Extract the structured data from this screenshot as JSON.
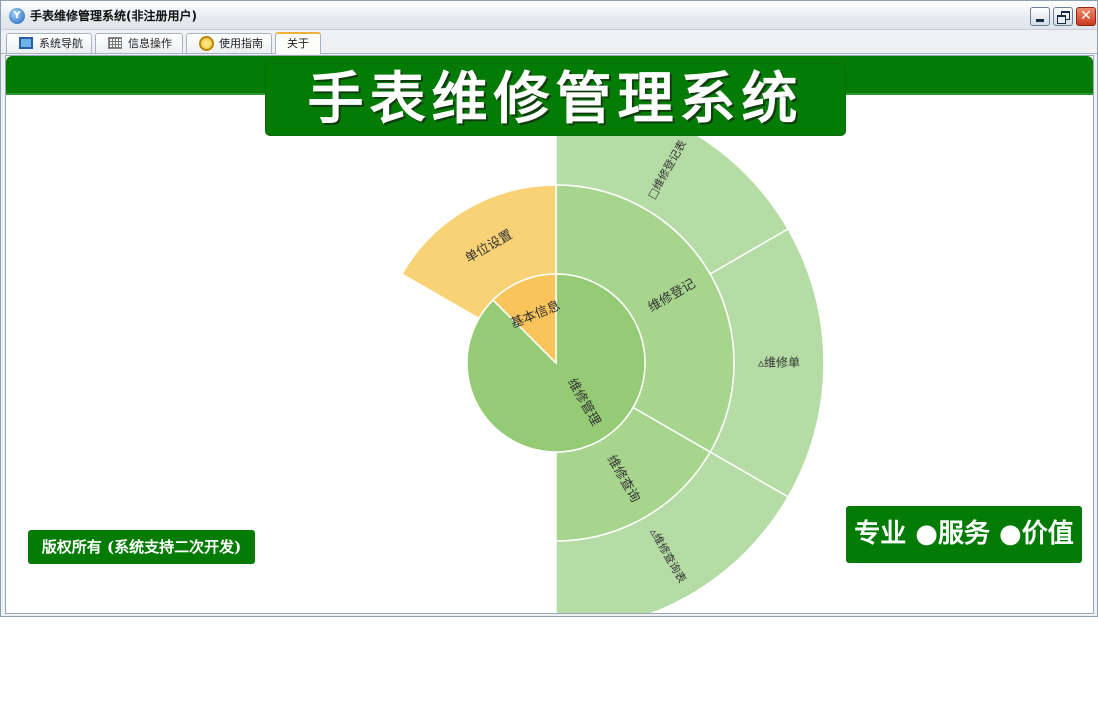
{
  "window": {
    "title": "手表维修管理系统(非注册用户)",
    "app_icon_glyph": "Y"
  },
  "tabs": [
    {
      "label": "系统导航",
      "icon": "monitor-icon"
    },
    {
      "label": "信息操作",
      "icon": "grid-icon"
    },
    {
      "label": "使用指南",
      "icon": "guide-icon"
    },
    {
      "label": "关于",
      "icon": ""
    }
  ],
  "active_tab": "关于",
  "banner": {
    "title": "手表维修管理系统"
  },
  "sunburst": {
    "colors": {
      "green_inner": "#94cb74",
      "green_mid": "#a7d58d",
      "green_outer": "#b5dca4",
      "yellow_inner": "#f9c45a",
      "yellow_mid": "#f9d276",
      "stroke": "#ffffff"
    },
    "center": {
      "label": "基本信息"
    },
    "rings": {
      "inner": [
        {
          "label": "维修管理",
          "share": 0.875,
          "color": "green"
        },
        {
          "label": "基本信息",
          "share": 0.125,
          "color": "yellow"
        }
      ],
      "middle": [
        {
          "label": "单位设置",
          "parent": "基本信息"
        },
        {
          "label": "维修登记",
          "parent": "维修管理"
        },
        {
          "label": "维修查询",
          "parent": "维修管理"
        }
      ],
      "outer": [
        {
          "label": "维修登记表",
          "parent": "维修登记"
        },
        {
          "label": "维修单",
          "parent": "维修登记"
        },
        {
          "label": "维修查询表",
          "parent": "维修查询"
        }
      ]
    }
  },
  "footer": {
    "copyright": "版权所有 (系统支持二次开发)",
    "slogan": "专业 ●服务 ●价值"
  }
}
